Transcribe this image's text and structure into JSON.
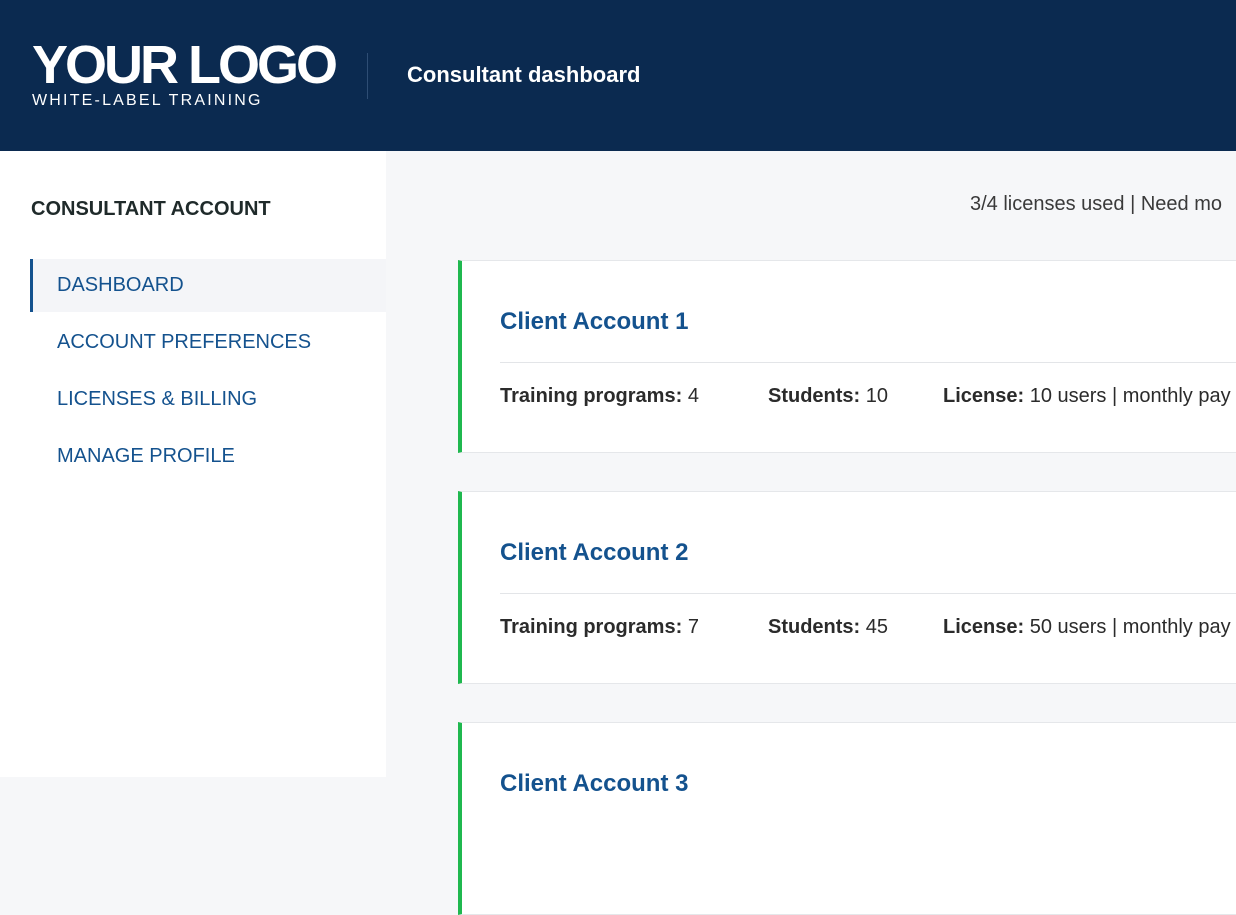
{
  "header": {
    "logo_main": "YOUR LOGO",
    "logo_sub": "WHITE-LABEL TRAINING",
    "title": "Consultant dashboard"
  },
  "sidebar": {
    "heading": "CONSULTANT ACCOUNT",
    "items": [
      {
        "label": "DASHBOARD",
        "active": true
      },
      {
        "label": "ACCOUNT PREFERENCES",
        "active": false
      },
      {
        "label": "LICENSES & BILLING",
        "active": false
      },
      {
        "label": "MANAGE PROFILE",
        "active": false
      }
    ]
  },
  "main": {
    "license_info": "3/4 licenses used | Need mo",
    "clients": [
      {
        "name": "Client Account 1",
        "programs_label": "Training programs:",
        "programs": "4",
        "students_label": "Students:",
        "students": "10",
        "license_label": "License:",
        "license": "10 users | monthly pay"
      },
      {
        "name": "Client Account 2",
        "programs_label": "Training programs:",
        "programs": "7",
        "students_label": "Students:",
        "students": "45",
        "license_label": "License:",
        "license": "50 users | monthly pay"
      },
      {
        "name": "Client Account 3"
      }
    ]
  },
  "colors": {
    "header_bg": "#0b2a50",
    "link_blue": "#14528e",
    "accent_green": "#1fb84f",
    "page_bg": "#f6f7f9"
  }
}
